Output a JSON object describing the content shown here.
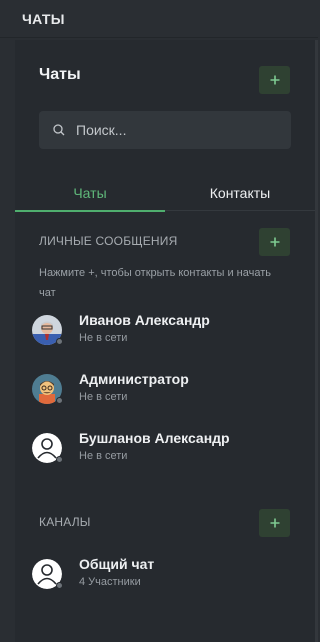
{
  "topbar": {
    "title": "ЧАТЫ"
  },
  "panel": {
    "title": "Чаты"
  },
  "search": {
    "placeholder": "Поиск..."
  },
  "tabs": [
    {
      "label": "Чаты",
      "active": true
    },
    {
      "label": "Контакты",
      "active": false
    }
  ],
  "personal": {
    "title": "ЛИЧНЫЕ СООБЩЕНИЯ",
    "hint": "Нажмите +, чтобы открыть контакты и начать чат",
    "items": [
      {
        "name": "Иванов Александр",
        "status": "Не в сети",
        "avatar": "photo-avatar"
      },
      {
        "name": "Администратор",
        "status": "Не в сети",
        "avatar": "illustrated-avatar"
      },
      {
        "name": "Бушланов Александр",
        "status": "Не в сети",
        "avatar": "user-placeholder-icon"
      }
    ]
  },
  "channels": {
    "title": "КАНАЛЫ",
    "items": [
      {
        "name": "Общий чат",
        "subtitle": "4 Участники",
        "avatar": "user-placeholder-icon"
      }
    ]
  },
  "colors": {
    "accent": "#5fb87a",
    "plus_button_bg": "#2f4132",
    "panel_bg": "#262a2f",
    "page_bg": "#2a2e33",
    "offline_dot": "#6d7379"
  }
}
